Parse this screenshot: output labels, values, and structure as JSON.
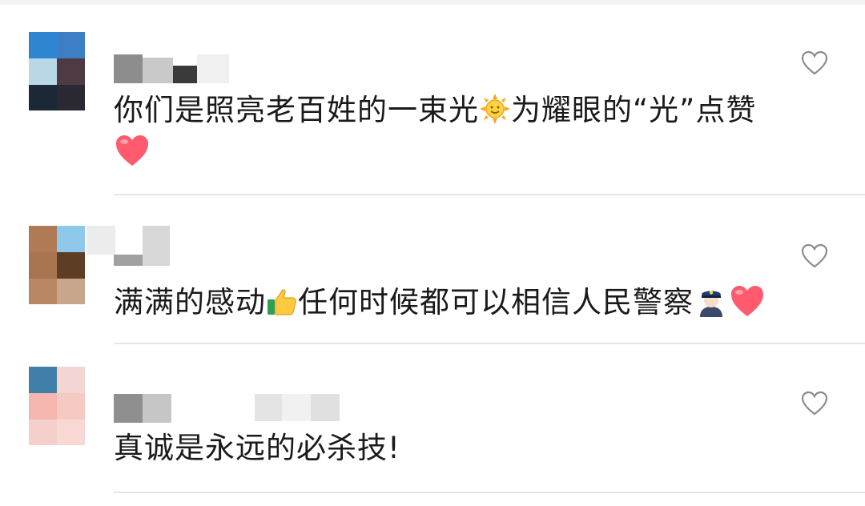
{
  "comments": [
    {
      "text_part1": "你们是照亮老百姓的一束光",
      "emoji1": "sun-emoji",
      "text_part2": "为耀眼的“光”点赞",
      "emoji2": "red-heart-emoji",
      "like_icon": "heart-outline-icon"
    },
    {
      "text_part1": "满满的感动",
      "emoji1": "thumbs-up-emoji",
      "text_part2": "任何时候都可以相信人民警察",
      "emoji2": "police-officer-emoji",
      "emoji3": "red-heart-emoji",
      "like_icon": "heart-outline-icon"
    },
    {
      "text_part1": "真诚是永远的必杀技!",
      "like_icon": "heart-outline-icon"
    }
  ],
  "colors": {
    "text": "#1a1a1a",
    "divider": "#e6e6e6",
    "heart_outline": "#8c8c8c",
    "heart_fill": "#ff5a6e"
  }
}
